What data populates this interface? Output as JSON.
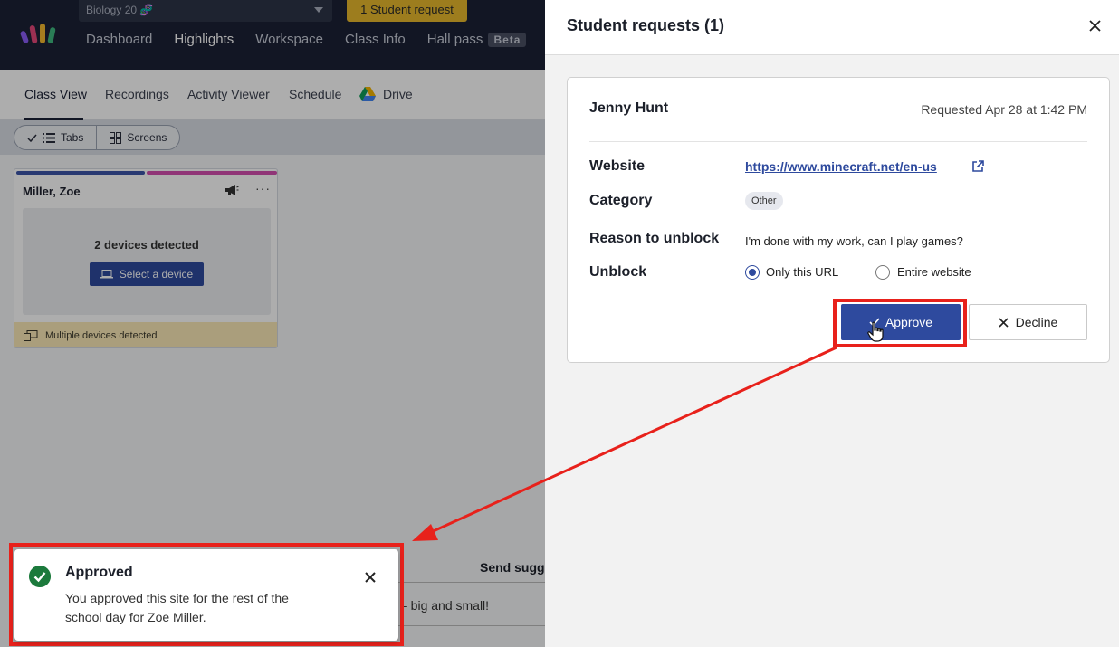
{
  "topbar": {
    "class_name": "Biology 20 🧬",
    "student_request_label": "1 Student request",
    "nav": [
      "Dashboard",
      "Highlights",
      "Workspace",
      "Class Info",
      "Hall pass"
    ],
    "beta_label": "Beta"
  },
  "subnav": [
    "Class View",
    "Recordings",
    "Activity Viewer",
    "Schedule",
    "Drive"
  ],
  "toolbar": {
    "tabs_label": "Tabs",
    "screens_label": "Screens"
  },
  "student_card": {
    "name": "Miller, Zoe",
    "devices_text": "2 devices detected",
    "select_device_label": "Select a device",
    "footer_text": "Multiple devices detected",
    "more_label": "···"
  },
  "bottom_panel": {
    "send_suggestions": "Send sugge",
    "big_small": "– big and small!"
  },
  "toast": {
    "title": "Approved",
    "message": "You approved this site for the rest of the school day for Zoe Miller."
  },
  "drawer": {
    "title": "Student requests (1)",
    "request": {
      "student": "Jenny Hunt",
      "requested_at": "Requested Apr 28 at 1:42 PM",
      "website_label": "Website",
      "website_url": "https://www.minecraft.net/en-us",
      "category_label": "Category",
      "category_value": "Other",
      "reason_label": "Reason to unblock",
      "reason_value": "I'm done with my work, can I play games?",
      "unblock_label": "Unblock",
      "unblock_options": [
        "Only this URL",
        "Entire website"
      ],
      "unblock_selected": "Only this URL",
      "approve_label": "Approve",
      "decline_label": "Decline"
    }
  },
  "colors": {
    "nav_bg": "#1b2135",
    "primary": "#2e4a9e",
    "request_badge": "#e7b92d",
    "success": "#1c7a3c",
    "annotation": "#e8211b"
  },
  "icons": [
    "logo-icon",
    "chevron-down-icon",
    "drive-icon",
    "check-icon",
    "list-icon",
    "grid-icon",
    "megaphone-icon",
    "more-icon",
    "laptop-icon",
    "devices-icon",
    "check-circle-icon",
    "close-icon",
    "external-link-icon",
    "hand-cursor-icon"
  ]
}
